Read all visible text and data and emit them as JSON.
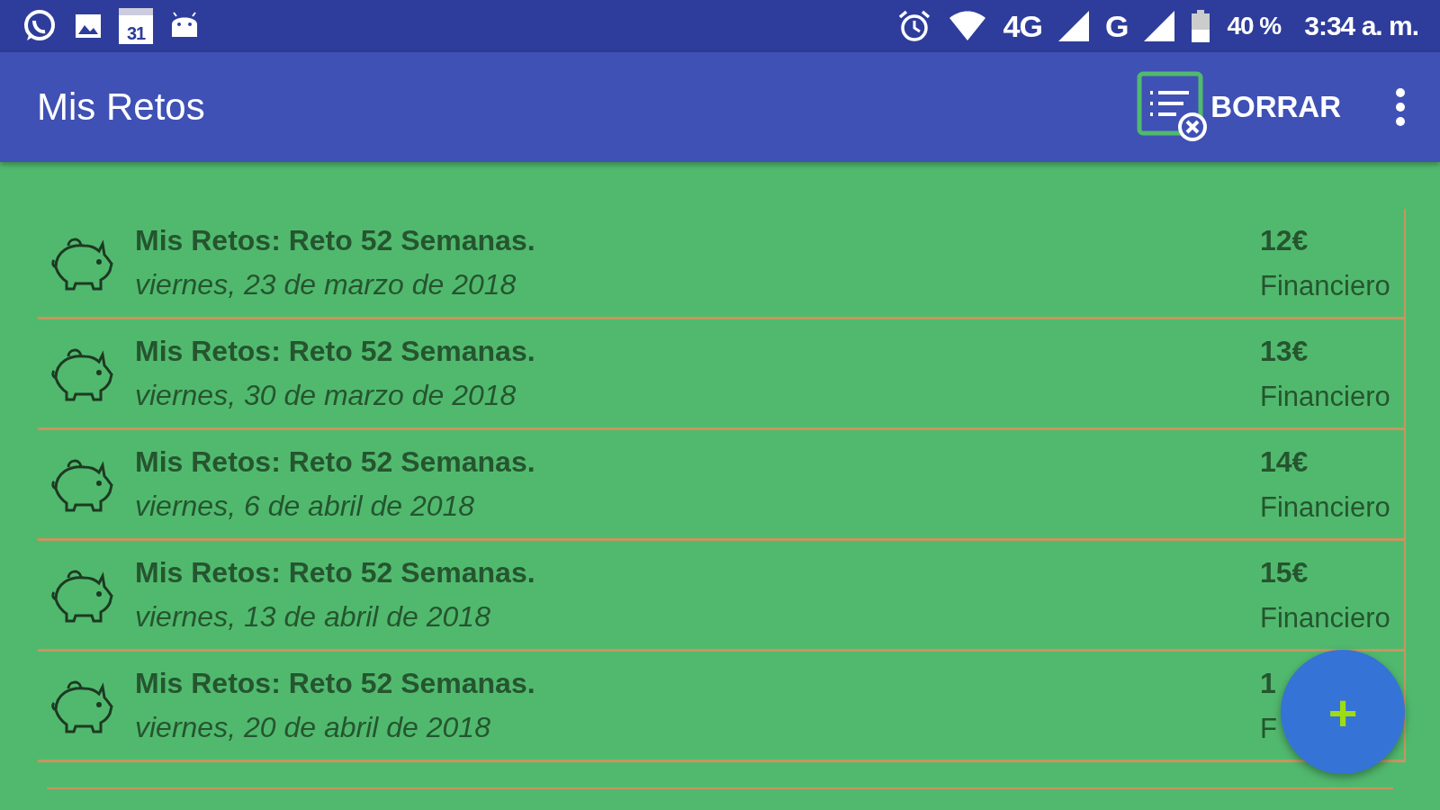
{
  "status_bar": {
    "calendar_day": "31",
    "network_primary": "4G",
    "network_secondary": "G",
    "battery": "40 %",
    "time": "3:34 a. m."
  },
  "app_bar": {
    "title": "Mis Retos",
    "action": "BORRAR"
  },
  "list": [
    {
      "title": "Mis Retos: Reto 52 Semanas.",
      "date": "viernes, 23 de marzo de 2018",
      "amount": "12€",
      "category": "Financiero"
    },
    {
      "title": "Mis Retos: Reto 52 Semanas.",
      "date": "viernes, 30 de marzo de 2018",
      "amount": "13€",
      "category": "Financiero"
    },
    {
      "title": "Mis Retos: Reto 52 Semanas.",
      "date": "viernes, 6 de abril de 2018",
      "amount": "14€",
      "category": "Financiero"
    },
    {
      "title": "Mis Retos: Reto 52 Semanas.",
      "date": "viernes, 13 de abril de 2018",
      "amount": "15€",
      "category": "Financiero"
    },
    {
      "title": "Mis Retos: Reto 52 Semanas.",
      "date": "viernes, 20 de abril de 2018",
      "amount": "1",
      "category": "F"
    }
  ],
  "fab": {
    "label": "+"
  }
}
